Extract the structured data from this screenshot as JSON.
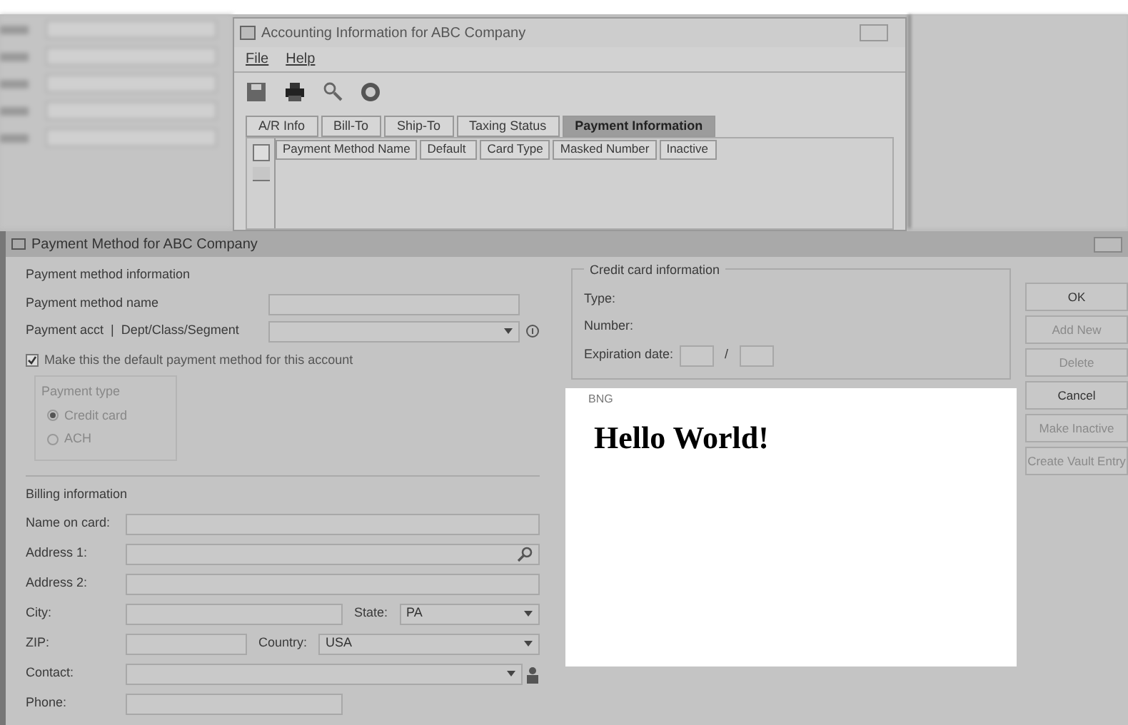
{
  "accounting_window": {
    "title": "Accounting Information for ABC Company",
    "menu": [
      "File",
      "Help"
    ],
    "tabs": [
      {
        "label": "A/R Info",
        "selected": false
      },
      {
        "label": "Bill-To",
        "selected": false
      },
      {
        "label": "Ship-To",
        "selected": false
      },
      {
        "label": "Taxing Status",
        "selected": false
      },
      {
        "label": "Payment Information",
        "selected": true
      }
    ],
    "columns": [
      "Payment Method Name",
      "Default",
      "Card Type",
      "Masked Number",
      "Inactive"
    ]
  },
  "payment_dialog": {
    "title": "Payment Method for ABC Company",
    "payment_method_info": {
      "heading": "Payment method information",
      "fields": [
        {
          "label": "Payment method name",
          "kind": "text"
        },
        {
          "label": "Payment acct  |  Dept/Class/Segment",
          "kind": "dropdown"
        }
      ],
      "default_checkbox": {
        "label": "Make this the default payment method for this account",
        "checked": true
      },
      "payment_type": {
        "heading": "Payment type",
        "disabled": true,
        "options": [
          {
            "label": "Credit card",
            "selected": true
          },
          {
            "label": "ACH",
            "selected": false
          }
        ]
      }
    },
    "billing": {
      "heading": "Billing information",
      "rows": [
        {
          "fields": [
            {
              "label": "Name on card:",
              "kind": "text"
            }
          ]
        },
        {
          "fields": [
            {
              "label": "Address 1:",
              "kind": "lookup"
            }
          ]
        },
        {
          "fields": [
            {
              "label": "Address 2:",
              "kind": "text"
            }
          ]
        },
        {
          "fields": [
            {
              "label": "City:",
              "kind": "text"
            },
            {
              "label": "State:",
              "kind": "dropdown",
              "value": "PA"
            }
          ]
        },
        {
          "fields": [
            {
              "label": "ZIP:",
              "kind": "text"
            },
            {
              "label": "Country:",
              "kind": "dropdown",
              "value": "USA"
            }
          ]
        },
        {
          "fields": [
            {
              "label": "Contact:",
              "kind": "contact"
            }
          ]
        },
        {
          "fields": [
            {
              "label": "Phone:",
              "kind": "text"
            }
          ]
        }
      ]
    },
    "credit_card": {
      "heading": "Credit card information",
      "type_label": "Type:",
      "number_label": "Number:",
      "expiration_label": "Expiration date:",
      "separator": "/"
    },
    "bng": {
      "label": "BNG",
      "text": "Hello World!"
    },
    "buttons": [
      {
        "label": "OK",
        "disabled": false
      },
      {
        "label": "Add New",
        "disabled": true
      },
      {
        "label": "Delete",
        "disabled": true
      },
      {
        "label": "Cancel",
        "disabled": false
      },
      {
        "label": "Make Inactive",
        "disabled": true
      },
      {
        "label": "Create Vault Entry",
        "disabled": true
      }
    ]
  }
}
